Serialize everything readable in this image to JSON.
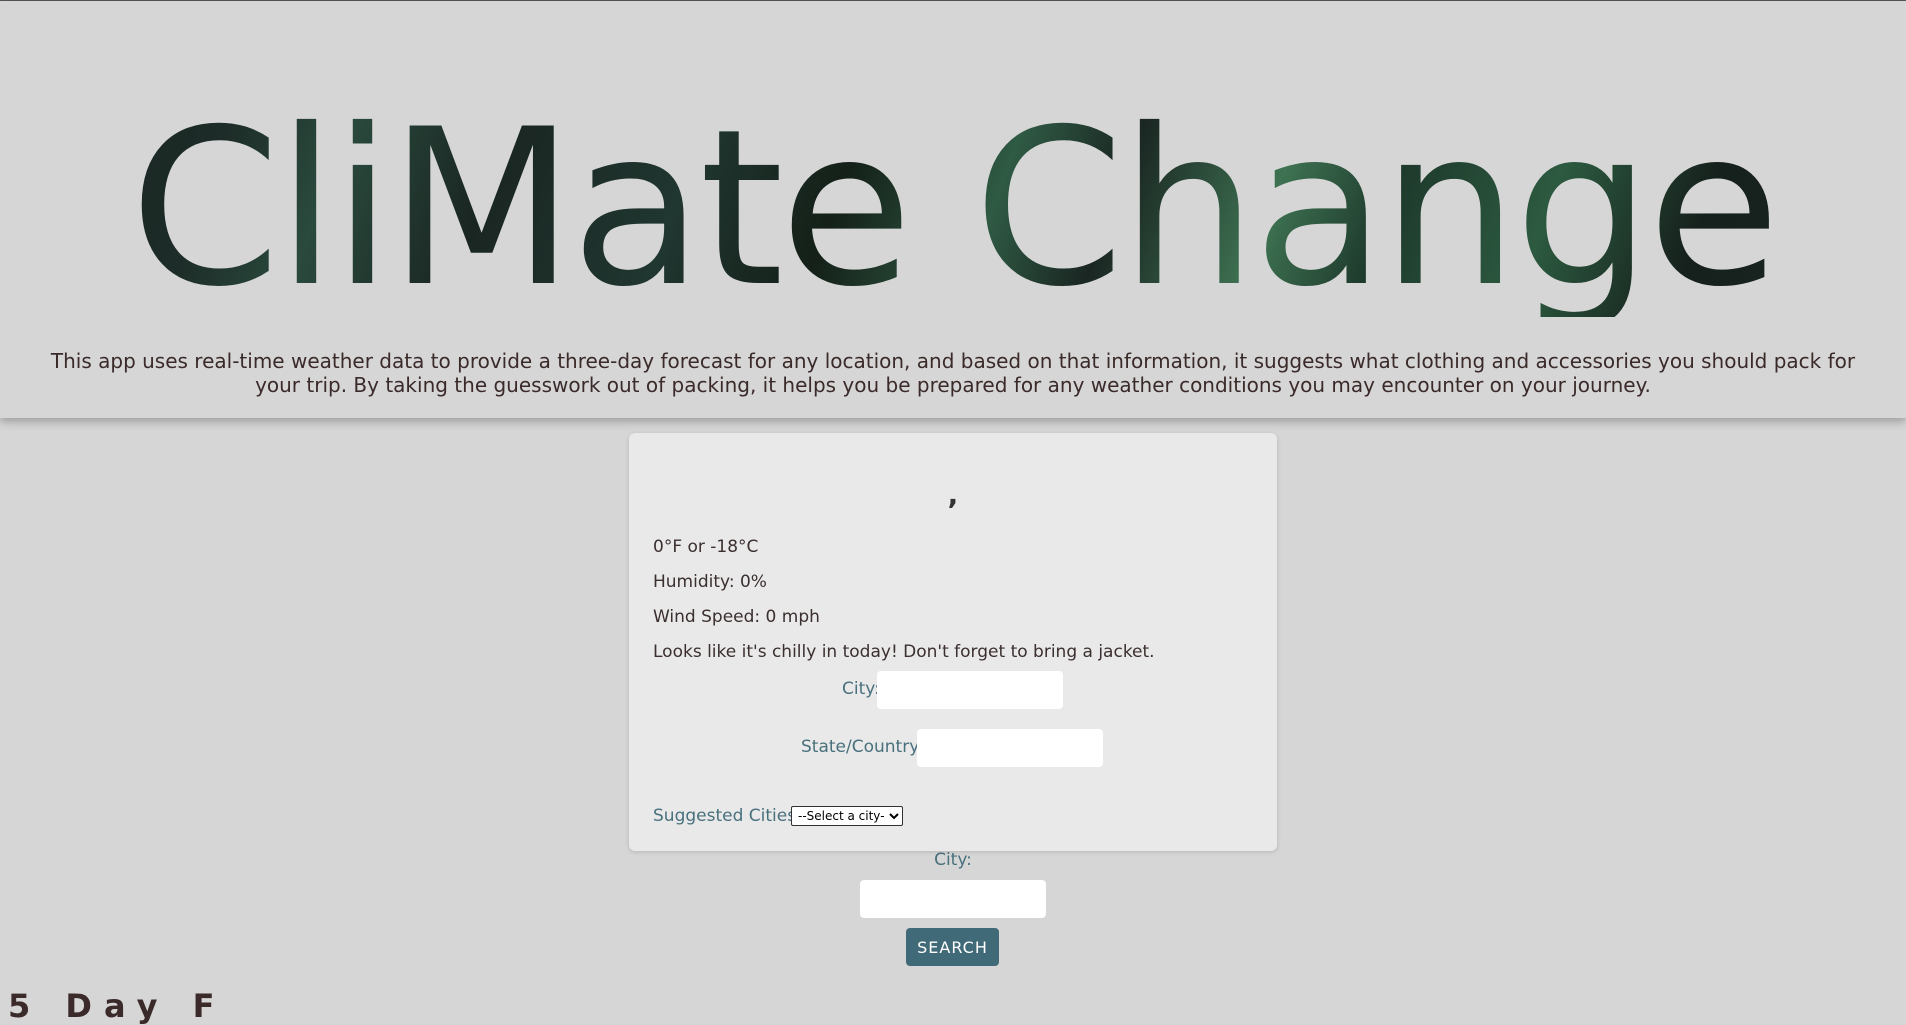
{
  "header": {
    "title": "CliMate Change",
    "description": "This app uses real-time weather data to provide a three-day forecast for any location, and based on that information, it suggests what clothing and accessories you should pack for your trip. By taking the guesswork out of packing, it helps you be prepared for any weather conditions you may encounter on your journey."
  },
  "weather": {
    "location": ",",
    "temperature": "0°F or -18°C",
    "humidity": "Humidity: 0%",
    "wind_speed": "Wind Speed: 0 mph",
    "message": "Looks like it's chilly in today! Don't forget to bring a jacket."
  },
  "form": {
    "city_label": "City:",
    "city_value": "",
    "state_label": "State/Country:",
    "state_value": "",
    "suggested_label": "Suggested Cities:",
    "select_value": "--Select a city--"
  },
  "search": {
    "city_label": "City:",
    "city_value": "",
    "button_label": "SEARCH"
  },
  "footer": {
    "clipped_text": "5 Day F"
  }
}
